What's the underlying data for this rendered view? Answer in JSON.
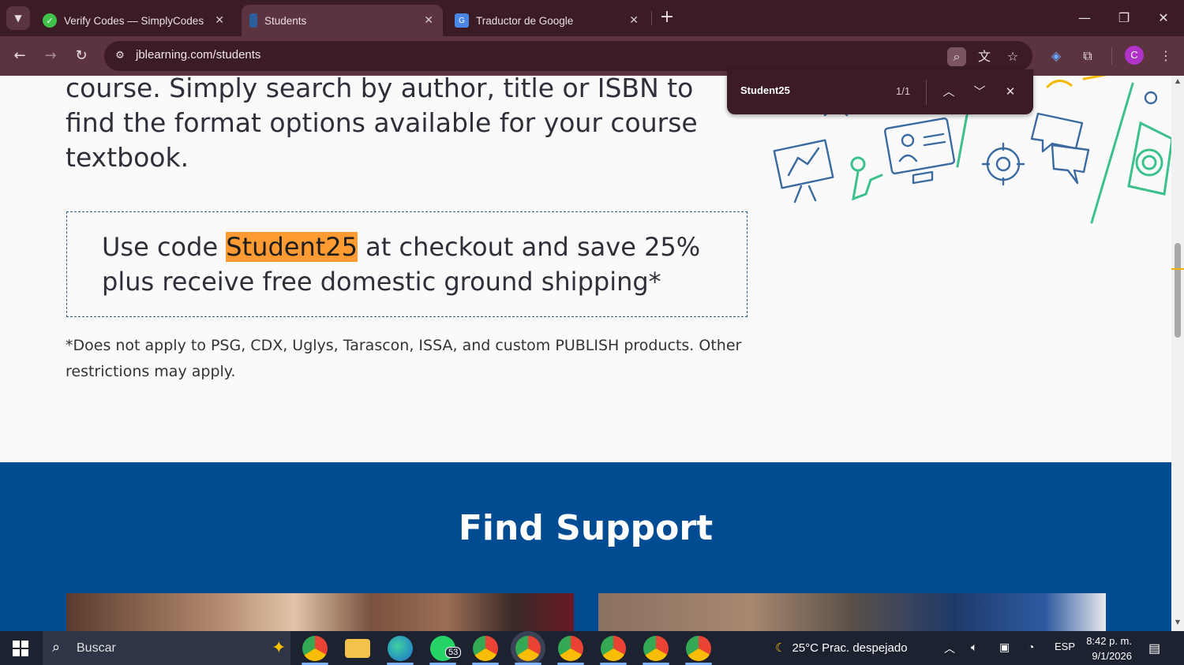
{
  "browser": {
    "tabs": [
      {
        "title": "Verify Codes — SimplyCodes",
        "active": false
      },
      {
        "title": "Students",
        "active": true
      },
      {
        "title": "Traductor de Google",
        "active": false
      }
    ],
    "new_tab_symbol": "+",
    "url": "jblearning.com/students",
    "profile_initial": "C"
  },
  "find_bar": {
    "query": "Student25",
    "count": "1/1"
  },
  "page": {
    "intro_text": "course. Simply search by author, title or ISBN to find the format options available for your course textbook.",
    "promo": {
      "prefix": "Use code ",
      "code": "Student25",
      "suffix": " at checkout and save 25% plus receive free domestic ground shipping*"
    },
    "disclaimer": "*Does not apply to PSG, CDX, Uglys, Tarascon, ISSA, and custom PUBLISH products. Other restrictions may apply.",
    "support_title": "Find Support"
  },
  "taskbar": {
    "search_placeholder": "Buscar",
    "whatsapp_badge": "53",
    "weather": "25°C  Prac. despejado",
    "language": "ESP",
    "time": "8:42 p. m.",
    "date": "9/1/2026"
  },
  "colors": {
    "highlight": "#ff9b32",
    "support_bg": "#004c93",
    "browser_frame": "#3b1b24",
    "browser_toolbar": "#5c3440"
  }
}
